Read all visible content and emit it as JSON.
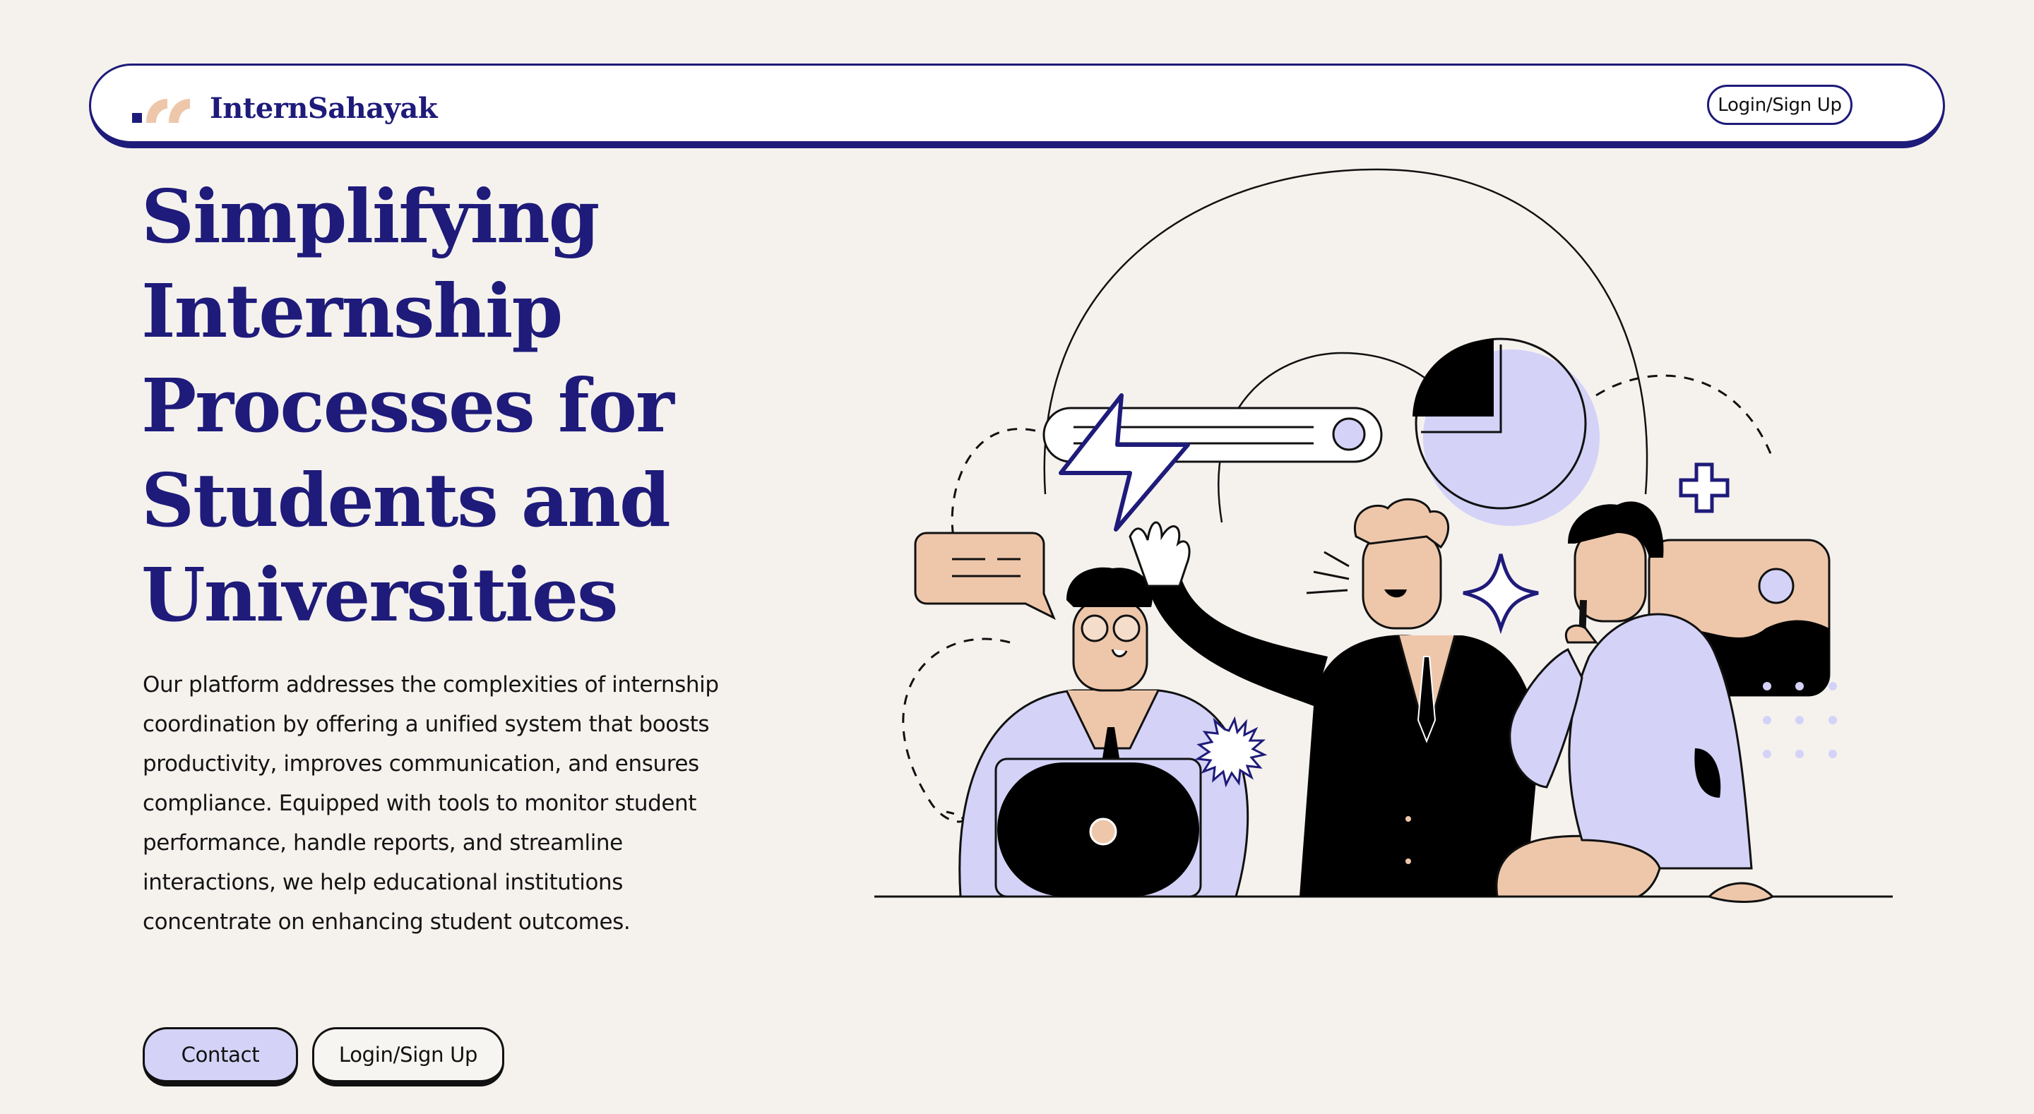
{
  "brand": {
    "name": "InternSahayak",
    "logo_colors": [
      "#1e1b7a",
      "#eec7ab"
    ]
  },
  "nav": {
    "login_label": "Login/Sign Up"
  },
  "hero": {
    "title_lines": [
      "Simplifying",
      "Internship",
      "Processes for",
      "Students and",
      "Universities"
    ],
    "description": "Our platform addresses the complexities of internship coordination by offering a unified system that boosts productivity, improves communication, and ensures compliance. Equipped with tools to monitor student performance, handle reports, and streamline interactions, we help educational institutions concentrate on enhancing student outcomes.",
    "buttons": {
      "contact": "Contact",
      "login": "Login/Sign Up"
    }
  },
  "colors": {
    "background": "#f5f2ee",
    "primary": "#1e1b7a",
    "accent_lavender": "#d4d2f7",
    "accent_peach": "#eec7ab"
  }
}
